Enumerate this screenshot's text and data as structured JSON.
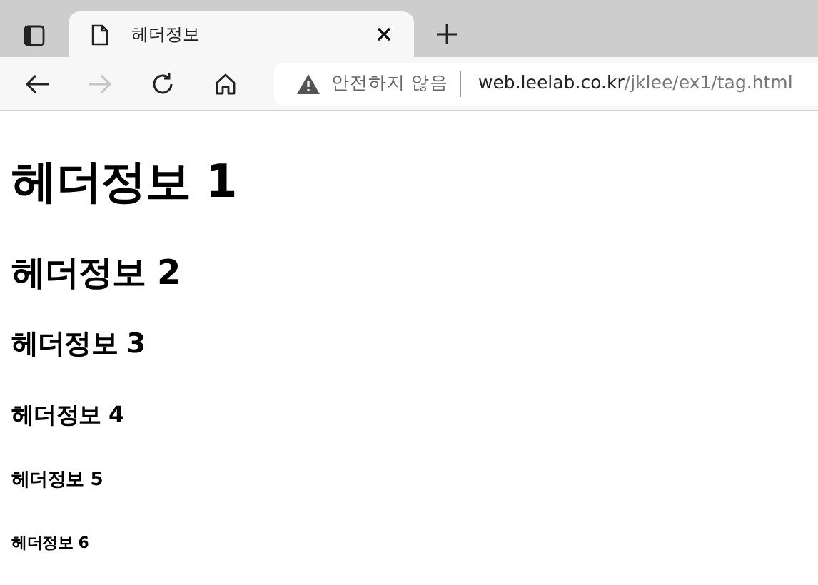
{
  "tab": {
    "title": "헤더정보",
    "selected": true
  },
  "toolbar": {
    "forward_disabled": true,
    "security": "안전하지 않음",
    "url_host": "web.leelab.co.kr",
    "url_path": "/jklee/ex1/tag.html"
  },
  "headings": [
    {
      "kind": "h1",
      "text": "헤더정보 1"
    },
    {
      "kind": "h2",
      "text": "헤더정보 2"
    },
    {
      "kind": "h3",
      "text": "헤더정보 3"
    },
    {
      "kind": "h4",
      "text": "헤더정보 4"
    },
    {
      "kind": "h5",
      "text": "헤더정보 5"
    },
    {
      "kind": "h6",
      "text": "헤더정보 6"
    }
  ]
}
